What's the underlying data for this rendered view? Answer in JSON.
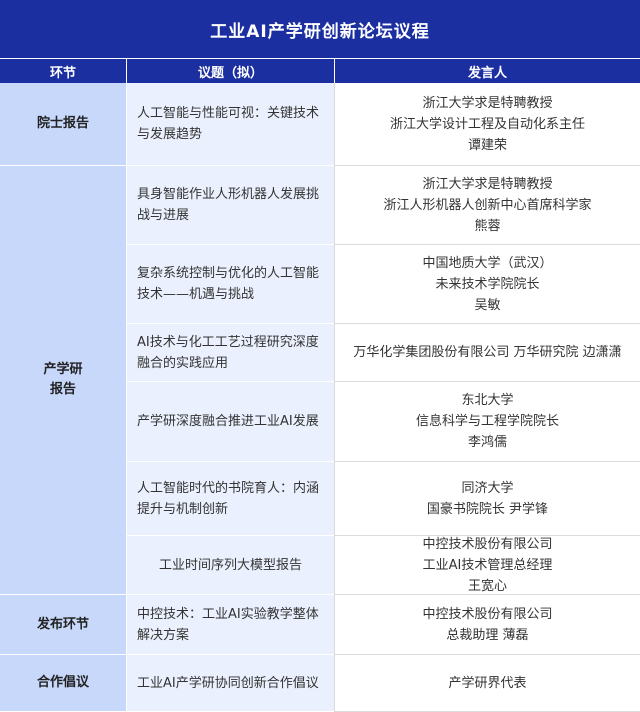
{
  "title": "工业AI产学研创新论坛议程",
  "headers": {
    "stage": "环节",
    "topic": "议题（拟）",
    "speaker": "发言人"
  },
  "stages": [
    {
      "lines": [
        "院士报告"
      ]
    },
    {
      "lines": [
        "产学研",
        "报告"
      ]
    },
    {
      "lines": [
        "发布环节"
      ]
    },
    {
      "lines": [
        "合作倡议"
      ]
    }
  ],
  "rows": [
    {
      "topic": "人工智能与性能可视：关键技术与发展趋势",
      "speaker": [
        "浙江大学求是特聘教授",
        "浙江大学设计工程及自动化系主任",
        "谭建荣"
      ]
    },
    {
      "topic": "具身智能作业人形机器人发展挑战与进展",
      "speaker": [
        "浙江大学求是特聘教授",
        "浙江人形机器人创新中心首席科学家",
        "熊蓉"
      ]
    },
    {
      "topic": "复杂系统控制与优化的人工智能技术——机遇与挑战",
      "speaker": [
        "中国地质大学（武汉）",
        "未来技术学院院长",
        "吴敏"
      ]
    },
    {
      "topic": "AI技术与化工工艺过程研究深度融合的实践应用",
      "speaker": [
        "万华化学集团股份有限公司 万华研究院 边潇潇"
      ]
    },
    {
      "topic": "产学研深度融合推进工业AI发展",
      "speaker": [
        "东北大学",
        "信息科学与工程学院院长",
        "李鸿儒"
      ]
    },
    {
      "topic": "人工智能时代的书院育人：内涵提升与机制创新",
      "speaker": [
        "同济大学",
        "国豪书院院长 尹学锋"
      ]
    },
    {
      "topic": "工业时间序列大模型报告",
      "speaker": [
        "中控技术股份有限公司",
        "工业AI技术管理总经理",
        "王宽心"
      ]
    },
    {
      "topic": "中控技术：工业AI实验教学整体解决方案",
      "speaker": [
        "中控技术股份有限公司",
        "总裁助理 薄磊"
      ]
    },
    {
      "topic": "工业AI产学研协同创新合作倡议",
      "speaker": [
        "产学研界代表"
      ]
    }
  ]
}
